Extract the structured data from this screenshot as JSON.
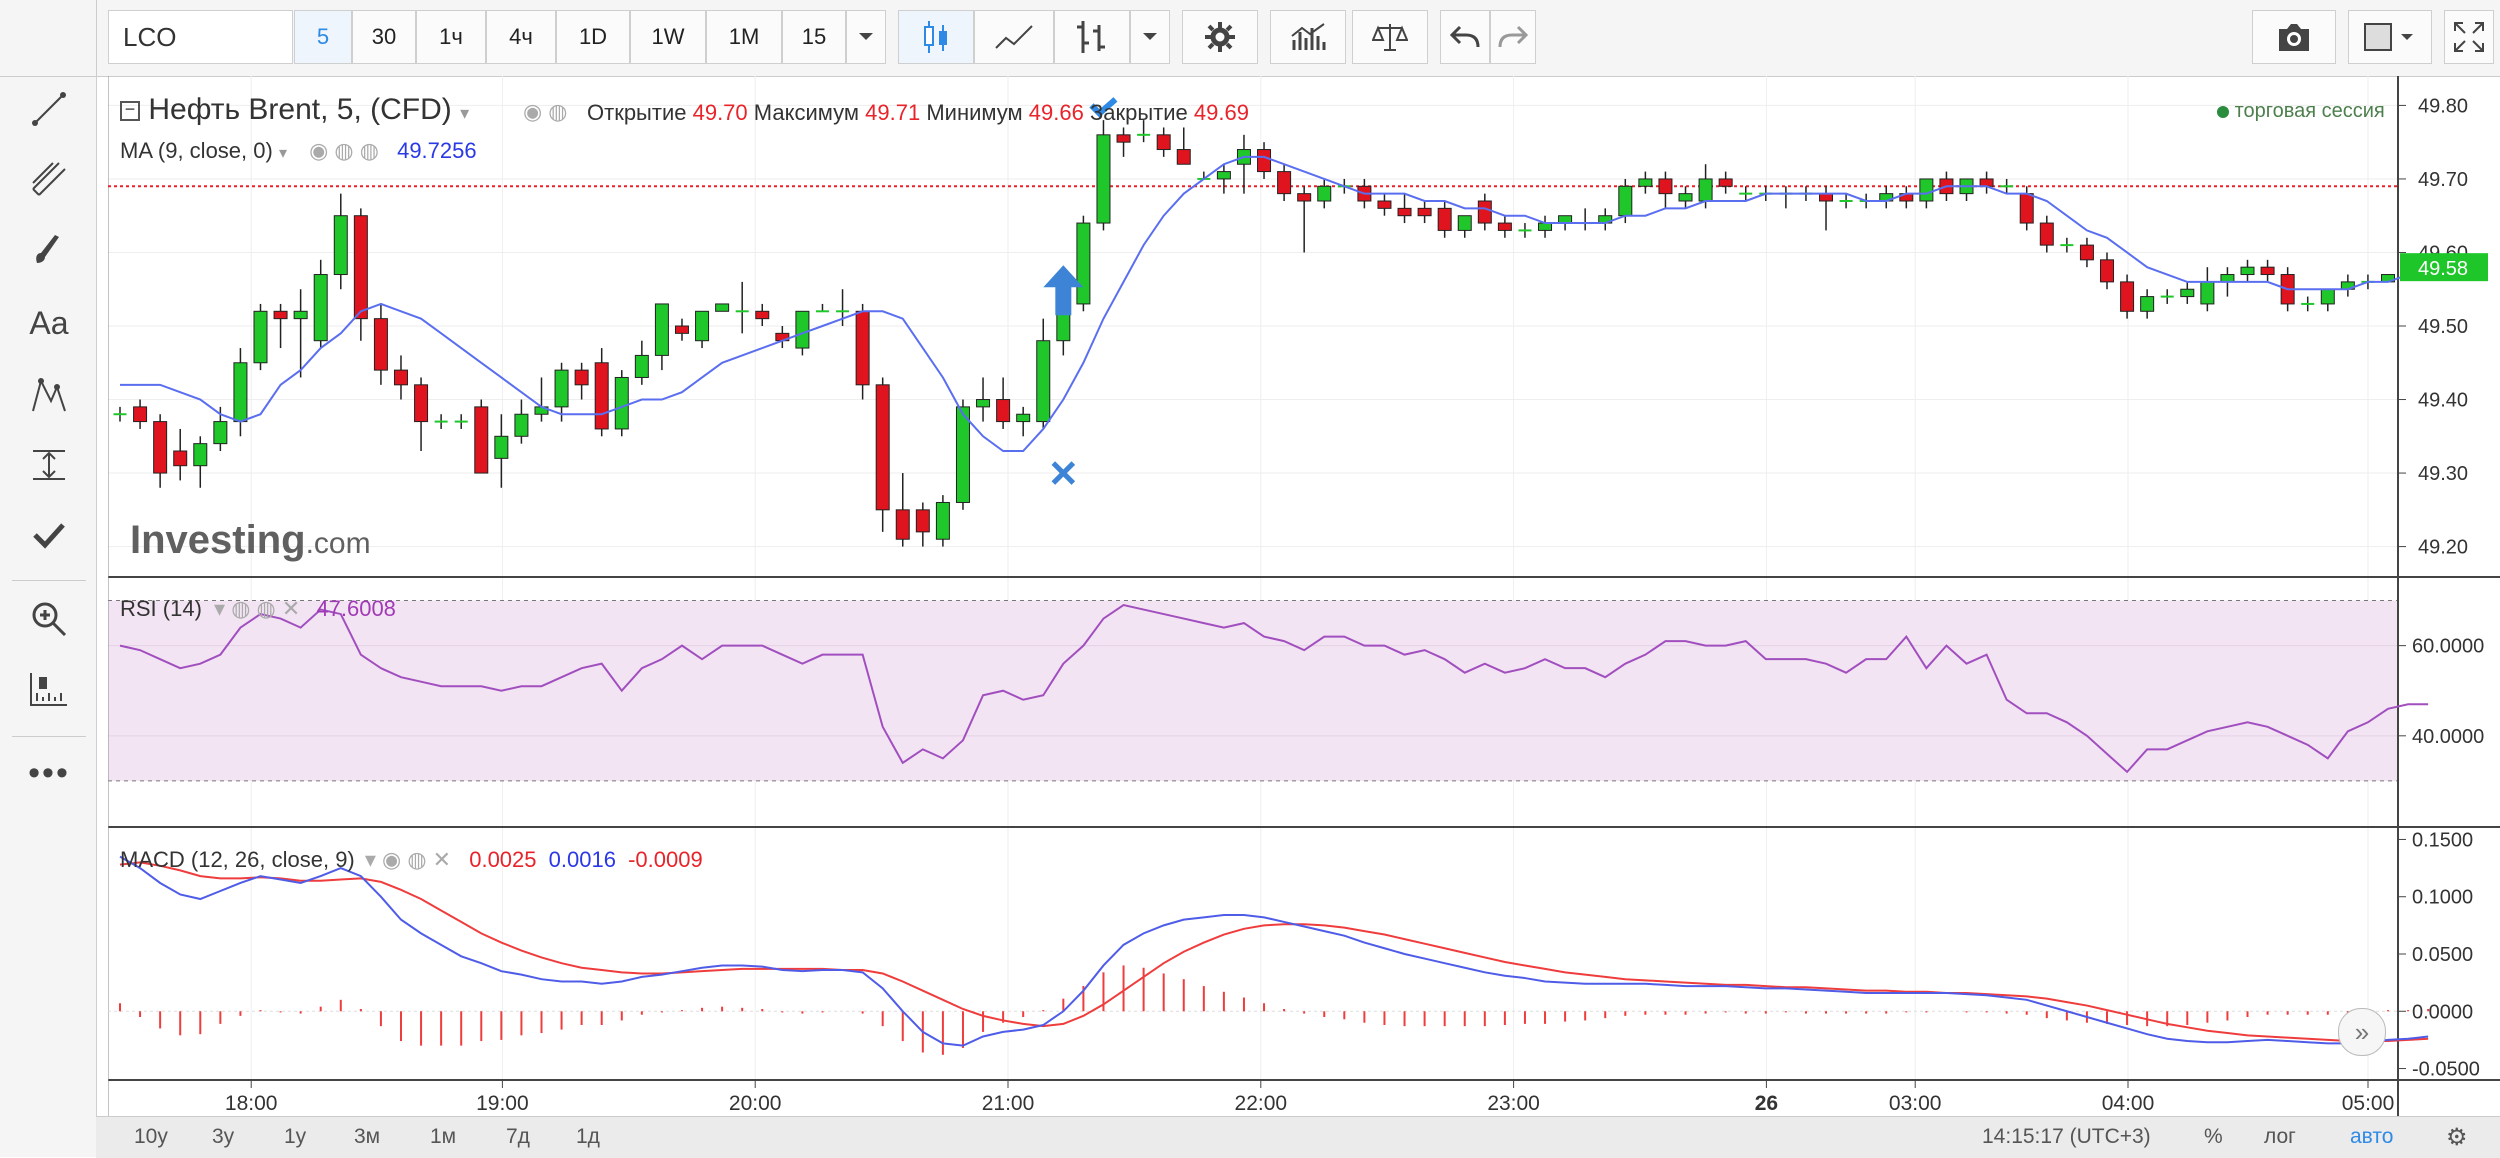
{
  "toolbar": {
    "symbol": "LCO",
    "intervals": [
      "5",
      "30",
      "1ч",
      "4ч",
      "1D",
      "1W",
      "1M",
      "15"
    ],
    "active_interval": "5"
  },
  "chart_title": "Нефть Brent, 5, (CFD)",
  "ohlc": {
    "open_label": "Открытие",
    "open": "49.70",
    "high_label": "Максимум",
    "high": "49.71",
    "low_label": "Минимум",
    "low": "49.66",
    "close_label": "Закрытие",
    "close": "49.69"
  },
  "ma_legend": {
    "label": "MA (9, close, 0)",
    "value": "49.7256"
  },
  "session_label": "торговая сессия",
  "watermark": {
    "main": "Investing",
    "suffix": ".com"
  },
  "rsi_legend": {
    "label": "RSI (14)",
    "value": "47.6008"
  },
  "macd_legend": {
    "label": "MACD (12, 26, close, 9)",
    "v1": "0.0025",
    "v2": "0.0016",
    "v3": "-0.0009"
  },
  "price_axis": [
    "49.80",
    "49.70",
    "49.60",
    "49.50",
    "49.40",
    "49.30",
    "49.20"
  ],
  "last_price": "49.58",
  "rsi_axis": [
    "60.0000",
    "40.0000"
  ],
  "macd_axis": [
    "0.1500",
    "0.1000",
    "0.0500",
    "0.0000",
    "-0.0500"
  ],
  "time_axis": [
    "18:00",
    "19:00",
    "20:00",
    "21:00",
    "22:00",
    "23:00",
    "26",
    "03:00",
    "04:00",
    "05:00"
  ],
  "ranges": [
    "10y",
    "3y",
    "1y",
    "3м",
    "1м",
    "7д",
    "1д"
  ],
  "status": {
    "time": "14:15:17 (UTC+3)",
    "pct": "%",
    "log": "лог",
    "auto": "авто"
  },
  "colors": {
    "up": "#20c72b",
    "down": "#e0141e",
    "ma": "#5a6ef0",
    "rsi": "#a14fbf",
    "macd": "#4f5ce8",
    "signal": "#ef3c3c",
    "hist": "#ef3c3c",
    "last_price_bg": "#1fc62a"
  },
  "chart_data": {
    "type": "candlestick",
    "x_labels": [
      "18:00",
      "19:00",
      "20:00",
      "21:00",
      "22:00",
      "23:00",
      "26",
      "03:00",
      "04:00",
      "05:00"
    ],
    "ylim": [
      49.16,
      49.84
    ],
    "candles": [
      [
        49.38,
        49.39,
        49.37,
        49.38
      ],
      [
        49.39,
        49.4,
        49.36,
        49.37
      ],
      [
        49.37,
        49.38,
        49.28,
        49.3
      ],
      [
        49.33,
        49.36,
        49.29,
        49.31
      ],
      [
        49.31,
        49.35,
        49.28,
        49.34
      ],
      [
        49.34,
        49.39,
        49.33,
        49.37
      ],
      [
        49.37,
        49.47,
        49.35,
        49.45
      ],
      [
        49.45,
        49.53,
        49.44,
        49.52
      ],
      [
        49.52,
        49.53,
        49.47,
        49.51
      ],
      [
        49.51,
        49.55,
        49.43,
        49.52
      ],
      [
        49.48,
        49.59,
        49.47,
        49.57
      ],
      [
        49.57,
        49.68,
        49.55,
        49.65
      ],
      [
        49.65,
        49.66,
        49.48,
        49.51
      ],
      [
        49.51,
        49.53,
        49.42,
        49.44
      ],
      [
        49.44,
        49.46,
        49.4,
        49.42
      ],
      [
        49.42,
        49.43,
        49.33,
        49.37
      ],
      [
        49.37,
        49.38,
        49.36,
        49.37
      ],
      [
        49.37,
        49.38,
        49.36,
        49.37
      ],
      [
        49.39,
        49.4,
        49.3,
        49.3
      ],
      [
        49.32,
        49.38,
        49.28,
        49.35
      ],
      [
        49.35,
        49.4,
        49.34,
        49.38
      ],
      [
        49.38,
        49.43,
        49.37,
        49.39
      ],
      [
        49.39,
        49.45,
        49.37,
        49.44
      ],
      [
        49.44,
        49.45,
        49.4,
        49.42
      ],
      [
        49.45,
        49.47,
        49.35,
        49.36
      ],
      [
        49.36,
        49.44,
        49.35,
        49.43
      ],
      [
        49.43,
        49.48,
        49.42,
        49.46
      ],
      [
        49.46,
        49.53,
        49.44,
        49.53
      ],
      [
        49.5,
        49.51,
        49.48,
        49.49
      ],
      [
        49.48,
        49.52,
        49.47,
        49.52
      ],
      [
        49.52,
        49.53,
        49.52,
        49.53
      ],
      [
        49.52,
        49.56,
        49.49,
        49.52
      ],
      [
        49.52,
        49.53,
        49.5,
        49.51
      ],
      [
        49.49,
        49.5,
        49.47,
        49.48
      ],
      [
        49.47,
        49.52,
        49.46,
        49.52
      ],
      [
        49.52,
        49.53,
        49.52,
        49.52
      ],
      [
        49.52,
        49.55,
        49.5,
        49.52
      ],
      [
        49.52,
        49.53,
        49.4,
        49.42
      ],
      [
        49.42,
        49.43,
        49.22,
        49.25
      ],
      [
        49.25,
        49.3,
        49.2,
        49.21
      ],
      [
        49.25,
        49.26,
        49.2,
        49.22
      ],
      [
        49.21,
        49.27,
        49.2,
        49.26
      ],
      [
        49.26,
        49.4,
        49.25,
        49.39
      ],
      [
        49.39,
        49.43,
        49.37,
        49.4
      ],
      [
        49.4,
        49.43,
        49.36,
        49.37
      ],
      [
        49.37,
        49.39,
        49.35,
        49.38
      ],
      [
        49.37,
        49.51,
        49.36,
        49.48
      ],
      [
        49.48,
        49.54,
        49.46,
        49.53
      ],
      [
        49.53,
        49.65,
        49.52,
        49.64
      ],
      [
        49.64,
        49.78,
        49.63,
        49.76
      ],
      [
        49.76,
        49.77,
        49.73,
        49.75
      ],
      [
        49.76,
        49.78,
        49.75,
        49.76
      ],
      [
        49.76,
        49.77,
        49.73,
        49.74
      ],
      [
        49.74,
        49.77,
        49.72,
        49.72
      ],
      [
        49.7,
        49.71,
        49.7,
        49.7
      ],
      [
        49.7,
        49.72,
        49.68,
        49.71
      ],
      [
        49.72,
        49.76,
        49.68,
        49.74
      ],
      [
        49.74,
        49.75,
        49.7,
        49.71
      ],
      [
        49.71,
        49.72,
        49.67,
        49.68
      ],
      [
        49.68,
        49.69,
        49.6,
        49.67
      ],
      [
        49.67,
        49.7,
        49.66,
        49.69
      ],
      [
        49.69,
        49.7,
        49.68,
        49.69
      ],
      [
        49.69,
        49.7,
        49.66,
        49.67
      ],
      [
        49.67,
        49.68,
        49.65,
        49.66
      ],
      [
        49.66,
        49.68,
        49.64,
        49.65
      ],
      [
        49.66,
        49.67,
        49.64,
        49.65
      ],
      [
        49.66,
        49.67,
        49.62,
        49.63
      ],
      [
        49.63,
        49.65,
        49.62,
        49.65
      ],
      [
        49.67,
        49.68,
        49.63,
        49.64
      ],
      [
        49.64,
        49.65,
        49.62,
        49.63
      ],
      [
        49.63,
        49.64,
        49.62,
        49.63
      ],
      [
        49.63,
        49.65,
        49.62,
        49.64
      ],
      [
        49.64,
        49.65,
        49.63,
        49.65
      ],
      [
        49.64,
        49.66,
        49.63,
        49.64
      ],
      [
        49.64,
        49.66,
        49.63,
        49.65
      ],
      [
        49.65,
        49.7,
        49.64,
        49.69
      ],
      [
        49.69,
        49.71,
        49.68,
        49.7
      ],
      [
        49.7,
        49.71,
        49.66,
        49.68
      ],
      [
        49.67,
        49.69,
        49.66,
        49.68
      ],
      [
        49.67,
        49.72,
        49.66,
        49.7
      ],
      [
        49.7,
        49.71,
        49.68,
        49.69
      ],
      [
        49.68,
        49.69,
        49.67,
        49.68
      ],
      [
        49.68,
        49.69,
        49.67,
        49.68
      ],
      [
        49.68,
        49.69,
        49.66,
        49.68
      ],
      [
        49.68,
        49.69,
        49.67,
        49.68
      ],
      [
        49.68,
        49.69,
        49.63,
        49.67
      ],
      [
        49.67,
        49.68,
        49.66,
        49.67
      ],
      [
        49.67,
        49.68,
        49.66,
        49.67
      ],
      [
        49.67,
        49.69,
        49.66,
        49.68
      ],
      [
        49.68,
        49.69,
        49.66,
        49.67
      ],
      [
        49.67,
        49.7,
        49.66,
        49.7
      ],
      [
        49.7,
        49.71,
        49.67,
        49.68
      ],
      [
        49.68,
        49.7,
        49.67,
        49.7
      ],
      [
        49.7,
        49.71,
        49.68,
        49.69
      ],
      [
        49.69,
        49.7,
        49.68,
        49.69
      ],
      [
        49.68,
        49.69,
        49.63,
        49.64
      ],
      [
        49.64,
        49.65,
        49.6,
        49.61
      ],
      [
        49.61,
        49.62,
        49.6,
        49.61
      ],
      [
        49.61,
        49.62,
        49.58,
        49.59
      ],
      [
        49.59,
        49.6,
        49.55,
        49.56
      ],
      [
        49.56,
        49.57,
        49.51,
        49.52
      ],
      [
        49.52,
        49.55,
        49.51,
        49.54
      ],
      [
        49.54,
        49.55,
        49.53,
        49.54
      ],
      [
        49.54,
        49.56,
        49.53,
        49.55
      ],
      [
        49.53,
        49.58,
        49.52,
        49.56
      ],
      [
        49.56,
        49.58,
        49.54,
        49.57
      ],
      [
        49.57,
        49.59,
        49.56,
        49.58
      ],
      [
        49.58,
        49.59,
        49.56,
        49.57
      ],
      [
        49.57,
        49.58,
        49.52,
        49.53
      ],
      [
        49.53,
        49.54,
        49.52,
        49.53
      ],
      [
        49.53,
        49.55,
        49.52,
        49.55
      ],
      [
        49.55,
        49.57,
        49.54,
        49.56
      ],
      [
        49.56,
        49.57,
        49.55,
        49.56
      ],
      [
        49.56,
        49.57,
        49.56,
        49.57
      ]
    ],
    "ma": [
      49.42,
      49.42,
      49.42,
      49.41,
      49.4,
      49.38,
      49.37,
      49.38,
      49.42,
      49.44,
      49.47,
      49.49,
      49.52,
      49.53,
      49.52,
      49.51,
      49.49,
      49.47,
      49.45,
      49.43,
      49.41,
      49.39,
      49.38,
      49.38,
      49.38,
      49.39,
      49.4,
      49.4,
      49.41,
      49.43,
      49.45,
      49.46,
      49.47,
      49.48,
      49.49,
      49.5,
      49.51,
      49.52,
      49.52,
      49.51,
      49.47,
      49.43,
      49.38,
      49.35,
      49.33,
      49.33,
      49.36,
      49.4,
      49.45,
      49.51,
      49.56,
      49.61,
      49.65,
      49.68,
      49.7,
      49.72,
      49.73,
      49.73,
      49.72,
      49.71,
      49.7,
      49.69,
      49.68,
      49.68,
      49.68,
      49.67,
      49.67,
      49.66,
      49.66,
      49.65,
      49.65,
      49.64,
      49.64,
      49.64,
      49.64,
      49.65,
      49.65,
      49.66,
      49.66,
      49.67,
      49.67,
      49.67,
      49.68,
      49.68,
      49.68,
      49.68,
      49.68,
      49.67,
      49.67,
      49.68,
      49.68,
      49.69,
      49.69,
      49.69,
      49.68,
      49.68,
      49.67,
      49.65,
      49.63,
      49.62,
      49.6,
      49.58,
      49.57,
      49.56,
      49.56,
      49.56,
      49.56,
      49.56,
      49.55,
      49.55,
      49.55,
      49.55,
      49.56,
      49.56,
      49.57
    ],
    "markers": [
      {
        "type": "check",
        "index": 49,
        "price": 49.8
      },
      {
        "type": "arrow-up",
        "index": 47,
        "price": 49.55
      },
      {
        "type": "cross",
        "index": 47,
        "price": 49.3
      }
    ],
    "hline": 49.69,
    "rsi": {
      "ylim": [
        20,
        75
      ],
      "upper": 70,
      "lower": 30,
      "values": [
        60,
        59,
        57,
        55,
        56,
        58,
        64,
        67,
        66,
        64,
        68,
        67,
        58,
        55,
        53,
        52,
        51,
        51,
        51,
        50,
        51,
        51,
        53,
        55,
        56,
        50,
        55,
        57,
        60,
        57,
        60,
        60,
        60,
        58,
        56,
        58,
        58,
        58,
        42,
        34,
        37,
        35,
        39,
        49,
        50,
        48,
        49,
        56,
        60,
        66,
        69,
        68,
        67,
        66,
        65,
        64,
        65,
        62,
        61,
        59,
        62,
        62,
        60,
        60,
        58,
        59,
        57,
        54,
        56,
        54,
        55,
        57,
        55,
        55,
        53,
        56,
        58,
        61,
        61,
        60,
        60,
        61,
        57,
        57,
        57,
        56,
        54,
        57,
        57,
        62,
        55,
        60,
        56,
        58,
        48,
        45,
        45,
        43,
        40,
        36,
        32,
        37,
        37,
        39,
        41,
        42,
        43,
        42,
        40,
        38,
        35,
        41,
        43,
        46,
        47,
        47
      ],
      "title": "RSI (14)"
    },
    "macd": {
      "ylim": [
        -0.06,
        0.16
      ],
      "macd": [
        0.135,
        0.125,
        0.112,
        0.102,
        0.098,
        0.105,
        0.112,
        0.118,
        0.115,
        0.112,
        0.118,
        0.125,
        0.118,
        0.1,
        0.08,
        0.068,
        0.058,
        0.048,
        0.042,
        0.035,
        0.032,
        0.028,
        0.026,
        0.026,
        0.024,
        0.026,
        0.03,
        0.032,
        0.035,
        0.038,
        0.04,
        0.04,
        0.039,
        0.036,
        0.035,
        0.036,
        0.036,
        0.034,
        0.02,
        0.0,
        -0.018,
        -0.028,
        -0.03,
        -0.022,
        -0.018,
        -0.016,
        -0.012,
        0.0,
        0.018,
        0.04,
        0.058,
        0.068,
        0.075,
        0.08,
        0.082,
        0.084,
        0.084,
        0.082,
        0.078,
        0.074,
        0.07,
        0.066,
        0.06,
        0.055,
        0.05,
        0.046,
        0.042,
        0.038,
        0.034,
        0.031,
        0.029,
        0.026,
        0.025,
        0.024,
        0.024,
        0.024,
        0.024,
        0.023,
        0.022,
        0.022,
        0.022,
        0.021,
        0.02,
        0.02,
        0.019,
        0.018,
        0.017,
        0.016,
        0.016,
        0.016,
        0.016,
        0.016,
        0.015,
        0.014,
        0.012,
        0.01,
        0.005,
        0.0,
        -0.005,
        -0.01,
        -0.015,
        -0.02,
        -0.024,
        -0.026,
        -0.027,
        -0.027,
        -0.026,
        -0.025,
        -0.026,
        -0.027,
        -0.028,
        -0.028,
        -0.027,
        -0.025,
        -0.024,
        -0.022
      ],
      "signal": [
        0.128,
        0.13,
        0.127,
        0.123,
        0.118,
        0.116,
        0.116,
        0.117,
        0.116,
        0.114,
        0.114,
        0.115,
        0.116,
        0.113,
        0.106,
        0.098,
        0.088,
        0.078,
        0.068,
        0.06,
        0.053,
        0.047,
        0.042,
        0.038,
        0.036,
        0.034,
        0.033,
        0.033,
        0.034,
        0.035,
        0.036,
        0.037,
        0.037,
        0.037,
        0.037,
        0.037,
        0.036,
        0.036,
        0.033,
        0.026,
        0.018,
        0.01,
        0.002,
        -0.004,
        -0.008,
        -0.011,
        -0.013,
        -0.011,
        -0.004,
        0.006,
        0.018,
        0.03,
        0.042,
        0.052,
        0.06,
        0.067,
        0.072,
        0.075,
        0.076,
        0.076,
        0.075,
        0.073,
        0.07,
        0.067,
        0.063,
        0.059,
        0.055,
        0.051,
        0.047,
        0.043,
        0.04,
        0.037,
        0.034,
        0.032,
        0.03,
        0.028,
        0.027,
        0.026,
        0.025,
        0.024,
        0.023,
        0.023,
        0.022,
        0.021,
        0.021,
        0.02,
        0.019,
        0.018,
        0.018,
        0.017,
        0.017,
        0.016,
        0.016,
        0.015,
        0.014,
        0.013,
        0.011,
        0.008,
        0.005,
        0.001,
        -0.003,
        -0.007,
        -0.011,
        -0.014,
        -0.017,
        -0.019,
        -0.021,
        -0.022,
        -0.023,
        -0.024,
        -0.025,
        -0.026,
        -0.026,
        -0.026,
        -0.025,
        -0.024
      ]
    }
  }
}
